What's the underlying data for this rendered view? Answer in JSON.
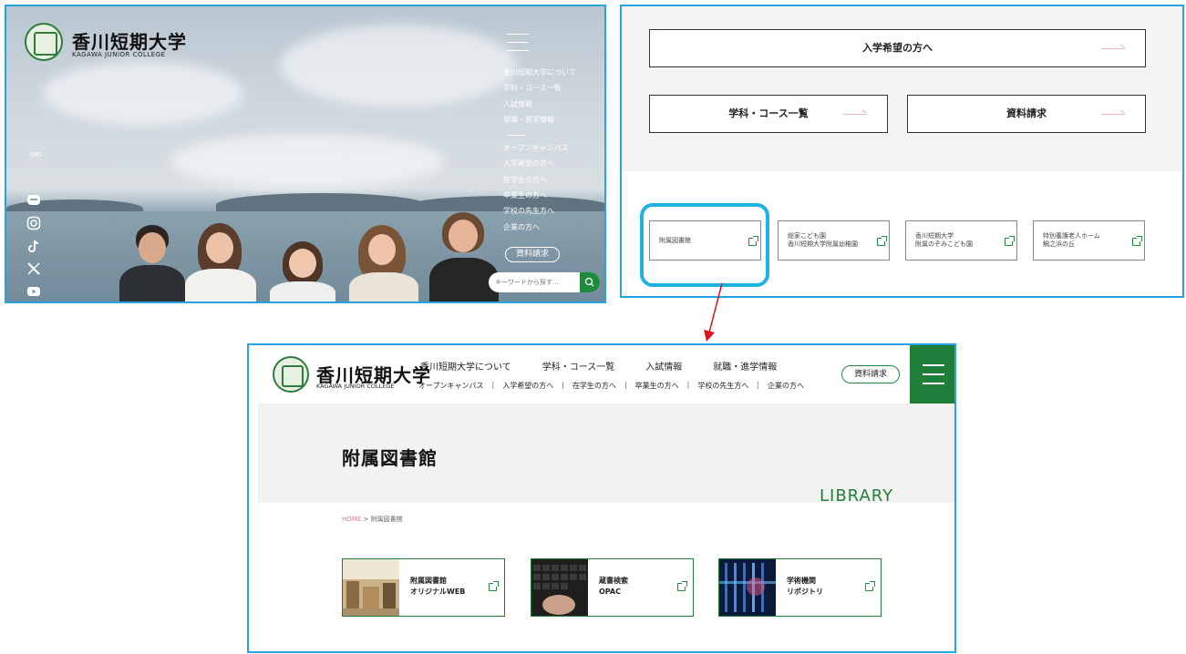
{
  "colors": {
    "accent_green": "#1f7f3a",
    "highlight_blue": "#1fb1e6",
    "panel_border": "#29a3e0",
    "arrow_red": "#e0141e",
    "link_arrow_pink": "#f2b6c6"
  },
  "hero": {
    "logo_title": "香川短期大学",
    "logo_sub": "KAGAWA JUNIOR COLLEGE",
    "menu_primary": [
      "香川短期大学について",
      "学科・コース一覧",
      "入試情報",
      "就職・進学情報"
    ],
    "menu_secondary": [
      "オープンキャンパス",
      "入学希望の方へ",
      "在学生の方へ",
      "卒業生の方へ",
      "学校の先生方へ",
      "企業の方へ"
    ],
    "request_label": "資料請求",
    "search_placeholder": "キーワードから探す...",
    "sns_label": "SNS",
    "sns_icons": [
      "line-icon",
      "instagram-icon",
      "tiktok-icon",
      "x-icon",
      "youtube-icon"
    ]
  },
  "menu_panel": {
    "prospective_button": "入学希望の方へ",
    "courses_button": "学科・コース一覧",
    "request_button": "資料請求",
    "cards": [
      {
        "line1": "附属図書館",
        "line2": ""
      },
      {
        "line1": "総家こども園",
        "line2": "香川短期大学附属幼稚園"
      },
      {
        "line1": "香川短期大学",
        "line2": "附属のぞみこども園"
      },
      {
        "line1": "特別養護老人ホーム",
        "line2": "鯛之浜の丘"
      }
    ]
  },
  "library": {
    "logo_title": "香川短期大学",
    "logo_sub": "KAGAWA JUNIOR COLLEGE",
    "top_nav": [
      "香川短期大学について",
      "学科・コース一覧",
      "入試情報",
      "就職・進学情報"
    ],
    "sub_nav": [
      "オープンキャンパス",
      "入学希望の方へ",
      "在学生の方へ",
      "卒業生の方へ",
      "学校の先生方へ",
      "企業の方へ"
    ],
    "request_label": "資料請求",
    "page_title": "附属図書館",
    "en_title": "LIBRARY",
    "breadcrumb_home": "HOME",
    "breadcrumb_sep": ">",
    "breadcrumb_current": "附属図書館",
    "cards": [
      {
        "line1": "附属図書館",
        "line2": "オリジナルWEB"
      },
      {
        "line1": "蔵書検索",
        "line2": "OPAC"
      },
      {
        "line1": "学術機関",
        "line2": "リポジトリ"
      }
    ]
  }
}
